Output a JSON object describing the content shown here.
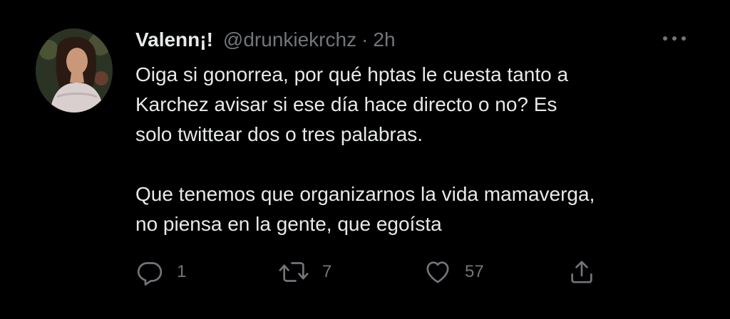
{
  "tweet": {
    "display_name": "Valenn¡!",
    "handle": "@drunkiekrchz",
    "separator": "·",
    "timestamp": "2h",
    "body_lines_1": [
      "Oiga si gonorrea, por qué hptas le cuesta tanto a",
      "Karchez avisar si ese día hace directo o no? Es",
      "solo twittear dos o tres palabras."
    ],
    "body_lines_2": [
      "Que tenemos que organizarnos la vida mamaverga,",
      "no piensa en la gente, que egoísta"
    ]
  },
  "actions": {
    "reply": {
      "icon": "reply-icon",
      "count": "1"
    },
    "retweet": {
      "icon": "retweet-icon",
      "count": "7"
    },
    "like": {
      "icon": "heart-icon",
      "count": "57"
    },
    "share": {
      "icon": "share-icon"
    }
  },
  "more": {
    "icon": "more-options-icon"
  },
  "colors": {
    "background": "#000000",
    "primary_text": "#e7e9ea",
    "secondary_text": "#71767b"
  }
}
